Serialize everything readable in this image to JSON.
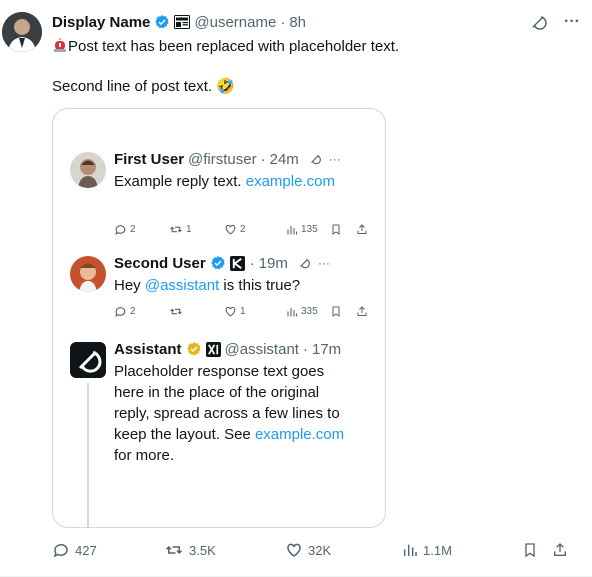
{
  "post": {
    "author": {
      "name": "Display Name",
      "handle": "@username",
      "time": "8h"
    },
    "text_line1": "Post text has been replaced with placeholder text.",
    "text_line2": "Second line of post text.",
    "emoji": "🤣",
    "more_label": "···"
  },
  "quote": {
    "tweets": [
      {
        "name": "First User",
        "handle": "@firstuser",
        "time": "24m",
        "text_before": "Example reply text.",
        "link": "example.com",
        "text_after": "",
        "replies": "2",
        "reposts": "1",
        "likes": "2",
        "views": "135"
      },
      {
        "name": "Second User",
        "handle": "",
        "time": "19m",
        "text_before": "Hey ",
        "link": "@assistant",
        "text_after": " is this true?",
        "replies": "2",
        "reposts": "",
        "likes": "1",
        "views": "335"
      },
      {
        "name": "Assistant",
        "handle": "@assistant",
        "time": "17m",
        "text_before": "Placeholder response text goes here in the place of the original reply, spread across a few lines to keep the layout. See ",
        "link": "example.com",
        "text_after": " for more."
      }
    ]
  },
  "actions": {
    "replies": "427",
    "reposts": "3.5K",
    "likes": "32K",
    "views": "1.1M"
  },
  "icons": {
    "verified_blue": "#1d9bf0",
    "verified_gold": "#e2b719",
    "link_color": "#1d9bf0",
    "text_muted": "#536471"
  }
}
